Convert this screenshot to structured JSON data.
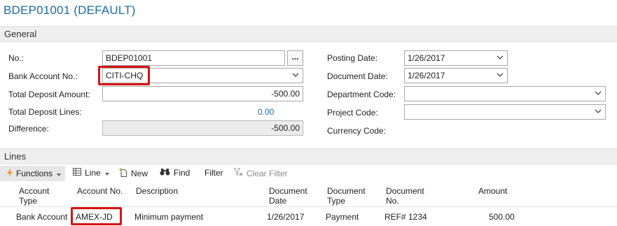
{
  "page": {
    "title": "BDEP01001 (DEFAULT)"
  },
  "general": {
    "section_label": "General",
    "no_label": "No.:",
    "no_value": "BDEP01001",
    "assist_button": "...",
    "bank_account_label": "Bank Account No.:",
    "bank_account_value": "CITI-CHQ",
    "total_amount_label": "Total Deposit Amount:",
    "total_amount_value": "-500.00",
    "total_lines_label": "Total Deposit Lines:",
    "total_lines_value": "0.00",
    "difference_label": "Difference:",
    "difference_value": "-500.00",
    "posting_date_label": "Posting Date:",
    "posting_date_value": "1/26/2017",
    "document_date_label": "Document Date:",
    "document_date_value": "1/26/2017",
    "department_code_label": "Department Code:",
    "department_code_value": "",
    "project_code_label": "Project Code:",
    "project_code_value": "",
    "currency_code_label": "Currency Code:"
  },
  "lines": {
    "section_label": "Lines",
    "toolbar": {
      "functions": "Functions",
      "line": "Line",
      "new": "New",
      "find": "Find",
      "filter": "Filter",
      "clear_filter": "Clear Filter"
    },
    "columns": {
      "account_type": [
        "Account",
        "Type"
      ],
      "account_no": [
        "Account No."
      ],
      "description": [
        "Description"
      ],
      "document_date": [
        "Document",
        "Date"
      ],
      "document_type": [
        "Document",
        "Type"
      ],
      "document_no": [
        "Document",
        "No."
      ],
      "amount": [
        "Amount"
      ]
    },
    "rows": [
      {
        "account_type": "Bank Account",
        "account_no": "AMEX-JD",
        "description": "Minimum payment",
        "document_date": "1/26/2017",
        "document_type": "Payment",
        "document_no": "REF# 1234",
        "amount": "500.00"
      }
    ]
  },
  "colors": {
    "title_blue": "#1a6aaa",
    "highlight_red": "#d61414",
    "functions_icon": "#e0a020"
  },
  "icons": [
    "chevron-down-icon",
    "lightning-icon",
    "caret-down-icon",
    "grid-icon",
    "new-document-icon",
    "binoculars-icon",
    "clear-filter-icon"
  ]
}
